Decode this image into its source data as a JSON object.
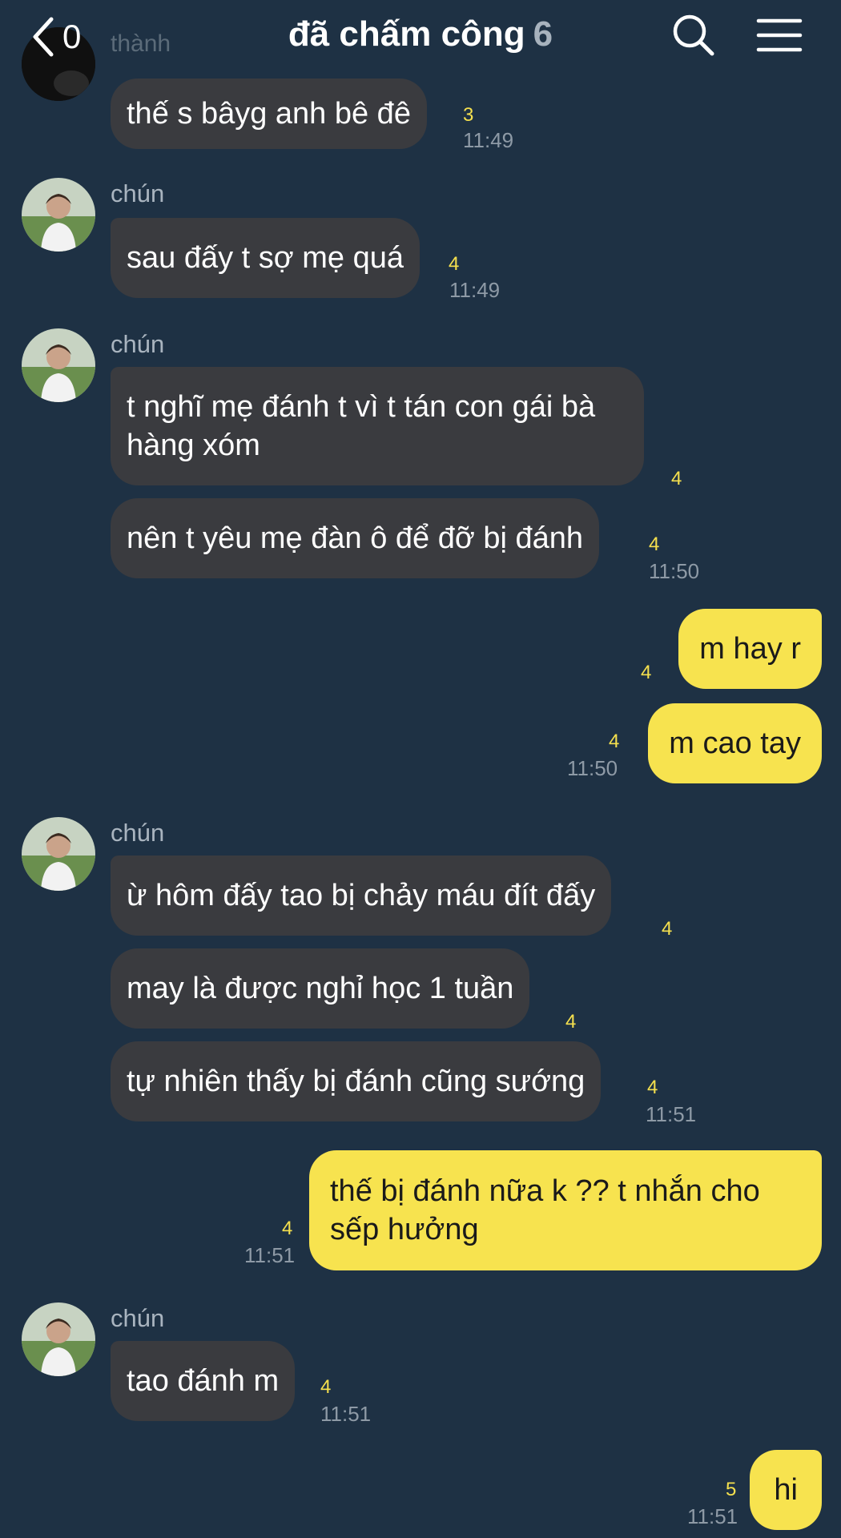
{
  "header": {
    "back_count": "0",
    "title": "đã chấm công",
    "member_count": "6"
  },
  "colors": {
    "background": "#1e3144",
    "received_bubble": "#3a3b3f",
    "sent_bubble": "#f7e34f",
    "unread_count": "#f5e04e"
  },
  "messages": [
    {
      "sender": "thành",
      "text": "thế s bâyg anh bê đê",
      "unread": "3",
      "time": "11:49",
      "direction": "received"
    },
    {
      "sender": "chún",
      "text": "sau đấy t sợ mẹ quá",
      "unread": "4",
      "time": "11:49",
      "direction": "received"
    },
    {
      "sender": "chún",
      "text": "t nghĩ mẹ đánh t vì t tán con gái bà hàng xóm",
      "unread": "4",
      "direction": "received"
    },
    {
      "text": "nên t yêu mẹ đàn ô để đỡ bị đánh",
      "unread": "4",
      "time": "11:50",
      "direction": "received"
    },
    {
      "text": "m hay r",
      "unread": "4",
      "direction": "sent"
    },
    {
      "text": "m cao tay",
      "unread": "4",
      "time": "11:50",
      "direction": "sent"
    },
    {
      "sender": "chún",
      "text": "ừ hôm đấy tao bị chảy máu đít đấy",
      "unread": "4",
      "direction": "received"
    },
    {
      "text": "may là được nghỉ học 1 tuần",
      "unread": "4",
      "direction": "received"
    },
    {
      "text": "tự nhiên thấy bị đánh cũng sướng",
      "unread": "4",
      "time": "11:51",
      "direction": "received"
    },
    {
      "text": "thế bị đánh nữa k ?? t nhắn cho sếp hưởng",
      "unread": "4",
      "time": "11:51",
      "direction": "sent"
    },
    {
      "sender": "chún",
      "text": "tao đánh m",
      "unread": "4",
      "time": "11:51",
      "direction": "received"
    },
    {
      "text": "hi",
      "unread": "5",
      "time": "11:51",
      "direction": "sent"
    }
  ]
}
